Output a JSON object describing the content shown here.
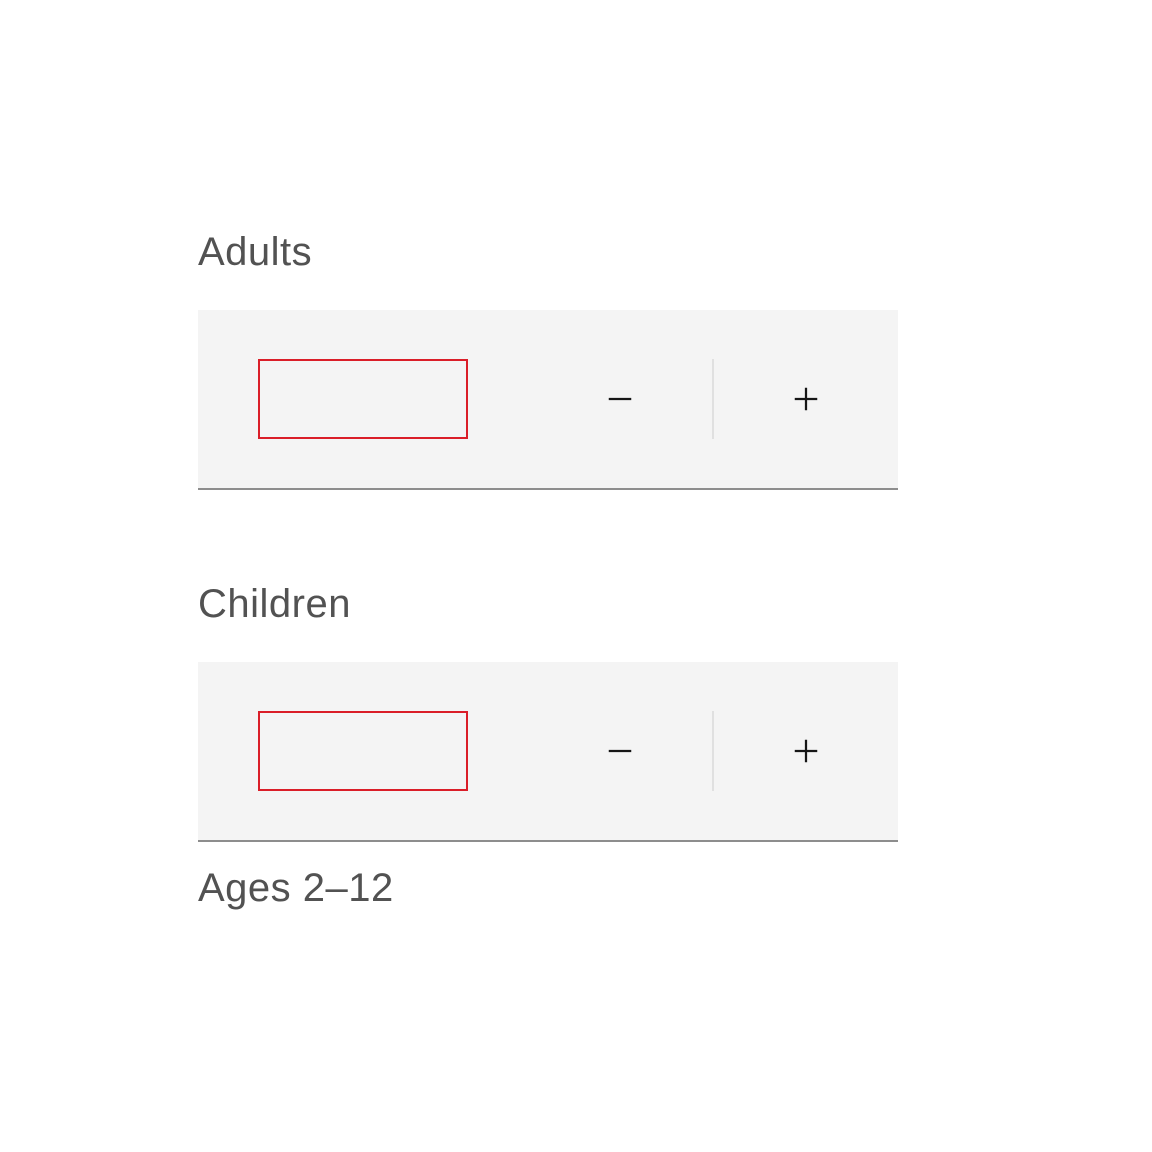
{
  "steppers": {
    "adults": {
      "label": "Adults",
      "value": ""
    },
    "children": {
      "label": "Children",
      "value": "",
      "helper": "Ages 2–12"
    }
  }
}
